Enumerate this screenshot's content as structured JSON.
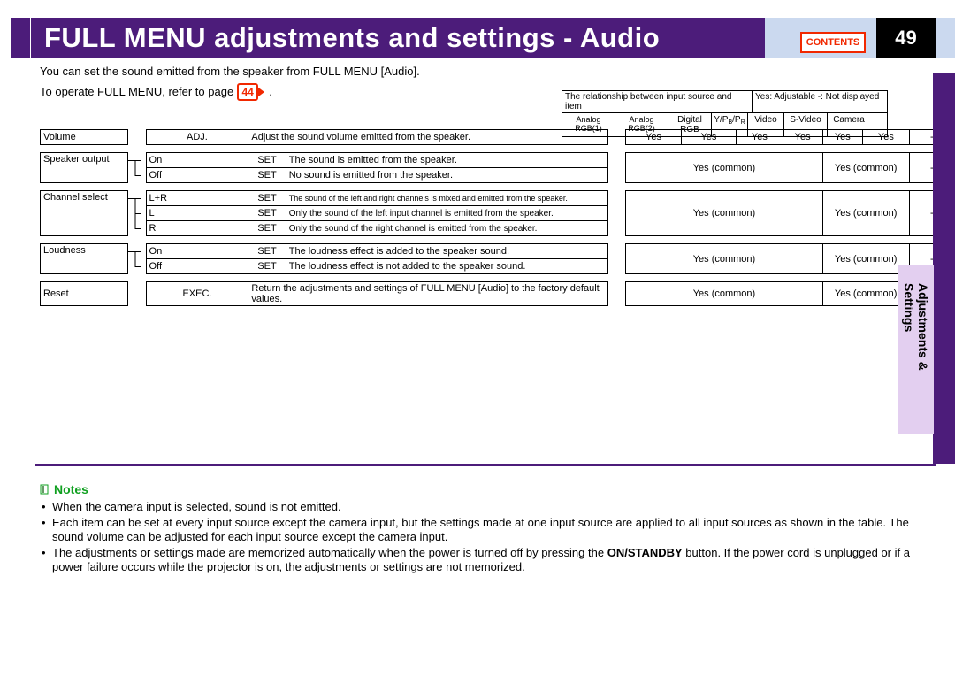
{
  "header": {
    "title": "FULL MENU adjustments and settings - Audio",
    "contents_label": "CONTENTS",
    "page_number": "49"
  },
  "intro": {
    "line1": "You can set the sound emitted from the speaker from FULL MENU [Audio].",
    "line2a": "To operate FULL MENU, refer to page ",
    "page_ref": "44",
    "line2b": " ."
  },
  "relheader": {
    "left": "The relationship between input source and item",
    "right": "Yes: Adjustable   -: Not displayed",
    "cols": [
      "Analog RGB(1)",
      "Analog RGB(2)",
      "Digital RGB",
      "Y/Pb/Pr",
      "Video",
      "S-Video",
      "Camera"
    ]
  },
  "tab": {
    "label1": "Adjustments &",
    "label2": "Settings"
  },
  "table": {
    "r_volume": {
      "name": "Volume",
      "type": "ADJ.",
      "desc": "Adjust the sound volume emitted from the speaker.",
      "vals": [
        "Yes",
        "Yes",
        "Yes",
        "Yes",
        "Yes",
        "Yes",
        "-"
      ]
    },
    "r_speaker": {
      "name": "Speaker output",
      "opts": [
        {
          "opt": "On",
          "type": "SET",
          "desc": "The sound is emitted from the speaker."
        },
        {
          "opt": "Off",
          "type": "SET",
          "desc": "No sound is emitted from the speaker."
        }
      ],
      "common_a": "Yes (common)",
      "common_b": "Yes (common)",
      "dash": "-"
    },
    "r_channel": {
      "name": "Channel select",
      "opts": [
        {
          "opt": "L+R",
          "type": "SET",
          "desc": "The sound of the left and right channels is mixed and emitted from the speaker."
        },
        {
          "opt": "L",
          "type": "SET",
          "desc": "Only the sound of the left input channel is emitted from the speaker."
        },
        {
          "opt": "R",
          "type": "SET",
          "desc": "Only the sound of the right channel is emitted from the speaker."
        }
      ],
      "common_a": "Yes (common)",
      "common_b": "Yes (common)",
      "dash": "-"
    },
    "r_loudness": {
      "name": "Loudness",
      "opts": [
        {
          "opt": "On",
          "type": "SET",
          "desc": "The loudness effect is added to the speaker sound."
        },
        {
          "opt": "Off",
          "type": "SET",
          "desc": "The loudness effect is not added to the speaker sound."
        }
      ],
      "common_a": "Yes (common)",
      "common_b": "Yes (common)",
      "dash": "-"
    },
    "r_reset": {
      "name": "Reset",
      "type": "EXEC.",
      "desc": "Return the adjustments and settings of FULL MENU [Audio] to the factory default values.",
      "common_a": "Yes (common)",
      "common_b": "Yes (common)",
      "dash": "-"
    }
  },
  "notes": {
    "heading": "Notes",
    "items": [
      "When the camera input is selected, sound is not emitted.",
      "Each item can be set at every input source except the camera input, but the settings made at one input source are applied to all input sources as shown in the table. The sound volume can be adjusted for each input source except the camera input.",
      "The adjustments or settings made are memorized automatically when the power is turned off by pressing the <b>ON/STANDBY</b> button. If the power cord is unplugged or if a power failure occurs while the projector is on, the adjustments or settings are not memorized."
    ]
  }
}
